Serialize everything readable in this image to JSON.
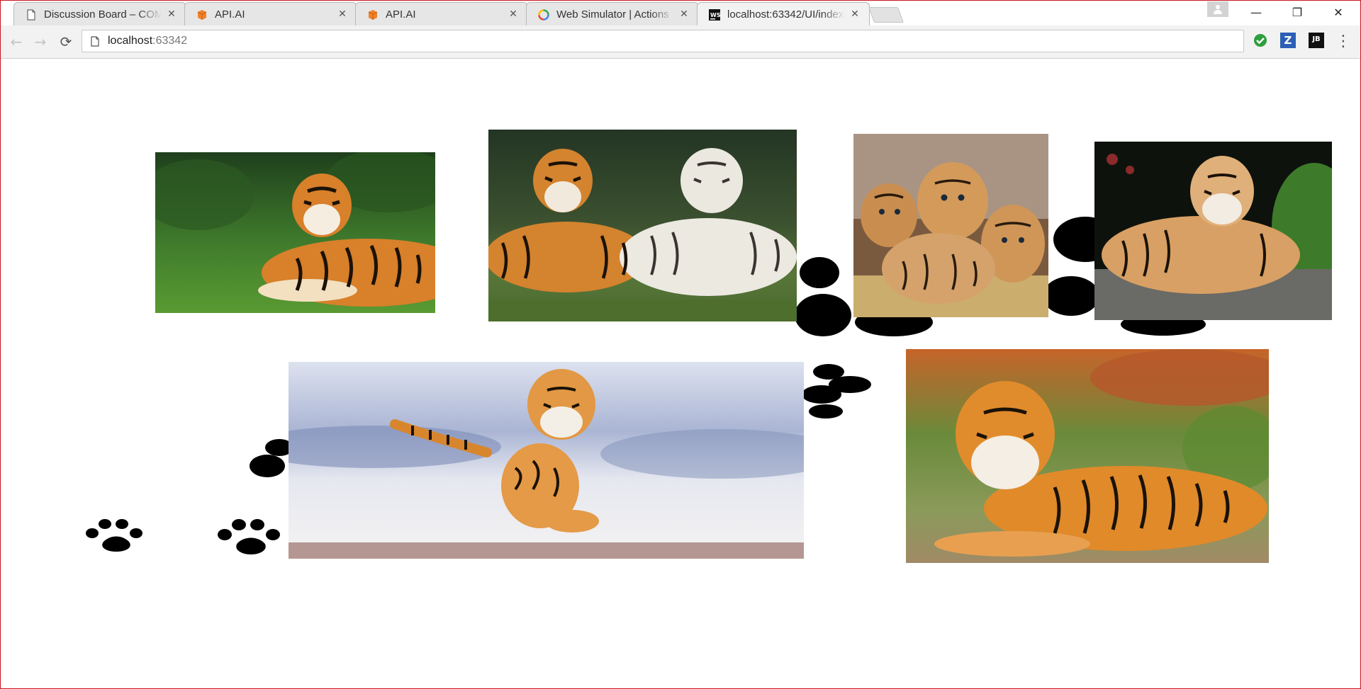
{
  "browser": {
    "tabs": [
      {
        "title": "Discussion Board – COMP",
        "icon": "document-icon",
        "active": false
      },
      {
        "title": "API.AI",
        "icon": "api-ai-icon",
        "active": false
      },
      {
        "title": "API.AI",
        "icon": "api-ai-icon",
        "active": false
      },
      {
        "title": "Web Simulator | Actions",
        "icon": "google-actions-icon",
        "active": false
      },
      {
        "title": "localhost:63342/UI/index",
        "icon": "webstorm-icon",
        "active": true
      }
    ],
    "close_glyph": "✕",
    "address": {
      "host": "localhost",
      "port": ":63342"
    },
    "window_controls": {
      "minimize": "—",
      "restore": "❐",
      "close": "✕"
    },
    "nav": {
      "back": "←",
      "forward": "→",
      "reload": "⟳",
      "menu": "⋮"
    },
    "extensions": [
      "checkmark-extension-icon",
      "z-extension-icon",
      "jetbrains-extension-icon"
    ],
    "ext_labels": {
      "z": "Z",
      "jb": "JB"
    }
  },
  "page": {
    "photos": [
      "tiger-lying-in-grass",
      "orange-and-white-tigers",
      "tiger-cubs-in-box",
      "tiger-on-rock",
      "tiger-running-in-snow",
      "tiger-lying-in-garden"
    ]
  },
  "colors": {
    "window_border": "#c9151e",
    "toolbar": "#f2f2f2",
    "tab_inactive": "#e6e6e6",
    "tab_active": "#f2f2f2",
    "tiger_orange": "#d8802a",
    "stripe": "#1b1208"
  }
}
